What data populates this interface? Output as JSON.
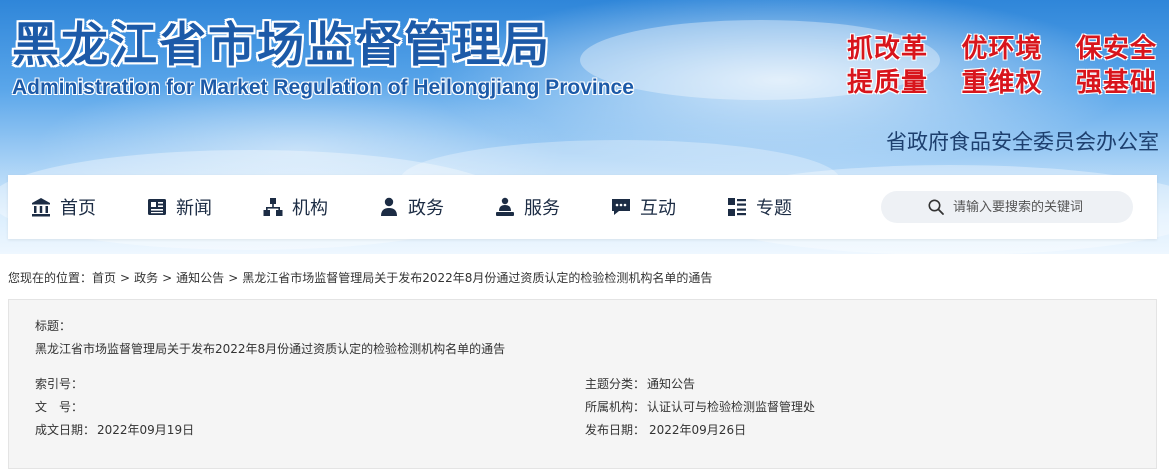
{
  "header": {
    "title_cn": "黑龙江省市场监督管理局",
    "title_en": "Administration for Market Regulation of Heilongjiang Province",
    "slogans": [
      [
        "抓改革",
        "优环境",
        "保安全"
      ],
      [
        "提质量",
        "重维权",
        "强基础"
      ]
    ],
    "office_link": "省政府食品安全委员会办公室"
  },
  "nav": {
    "items": [
      {
        "label": "首页",
        "icon": "home-icon"
      },
      {
        "label": "新闻",
        "icon": "news-icon"
      },
      {
        "label": "机构",
        "icon": "organization-icon"
      },
      {
        "label": "政务",
        "icon": "government-affairs-icon"
      },
      {
        "label": "服务",
        "icon": "service-icon"
      },
      {
        "label": "互动",
        "icon": "interaction-icon"
      },
      {
        "label": "专题",
        "icon": "topics-icon"
      }
    ],
    "search_placeholder": "请输入要搜索的关键词"
  },
  "breadcrumb": {
    "prefix": "您现在的位置：",
    "items": [
      "首页",
      "政务",
      "通知公告",
      "黑龙江省市场监督管理局关于发布2022年8月份通过资质认定的检验检测机构名单的通告"
    ],
    "separator": ">"
  },
  "info": {
    "title_label": "标题：",
    "title_value": "黑龙江省市场监督管理局关于发布2022年8月份通过资质认定的检验检测机构名单的通告",
    "index_label": "索引号：",
    "index_value": "",
    "doc_no_label": "文　号：",
    "doc_no_value": "",
    "created_label": "成文日期：",
    "created_value": "2022年09月19日",
    "category_label": "主题分类：",
    "category_value": "通知公告",
    "org_label": "所属机构：",
    "org_value": "认证认可与检验检测监督管理处",
    "published_label": "发布日期：",
    "published_value": "2022年09月26日"
  },
  "colors": {
    "title_blue": "#1c5aa8",
    "slogan_red": "#d8151c",
    "nav_text": "#1c2c44"
  }
}
